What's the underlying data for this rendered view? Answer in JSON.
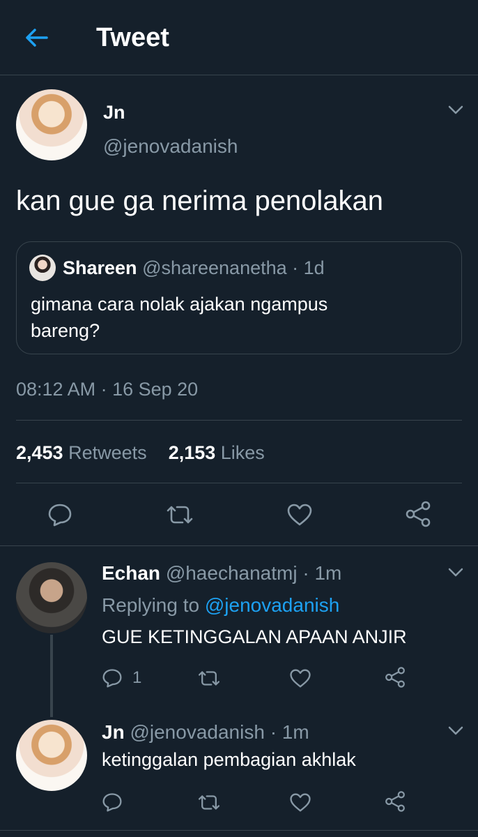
{
  "header": {
    "title": "Tweet",
    "back_icon": "arrow-left-icon"
  },
  "colors": {
    "background": "#15202b",
    "accent": "#1da1f2",
    "muted": "#8899a6",
    "border": "#38444d"
  },
  "main_tweet": {
    "display_name": "Jn",
    "handle": "@jenovadanish",
    "text": "kan gue ga nerima penolakan",
    "quoted": {
      "display_name": "Shareen",
      "handle": "@shareenanetha",
      "time": "· 1d",
      "text_line1": "gimana cara nolak ajakan ngampus",
      "text_line2": "bareng?"
    },
    "timestamp": "08:12 AM · 16 Sep 20",
    "stats": {
      "retweets_count": "2,453",
      "retweets_label": "Retweets",
      "likes_count": "2,153",
      "likes_label": "Likes"
    }
  },
  "replies": [
    {
      "display_name": "Echan",
      "handle": "@haechanatmj",
      "time": "· 1m",
      "replying_to_label": "Replying to",
      "replying_to_handle": "@jenovadanish",
      "text": "GUE KETINGGALAN APAAN ANJIR",
      "reply_count": "1"
    },
    {
      "display_name": "Jn",
      "handle": "@jenovadanish",
      "time": "· 1m",
      "text": "ketinggalan pembagian akhlak"
    }
  ]
}
